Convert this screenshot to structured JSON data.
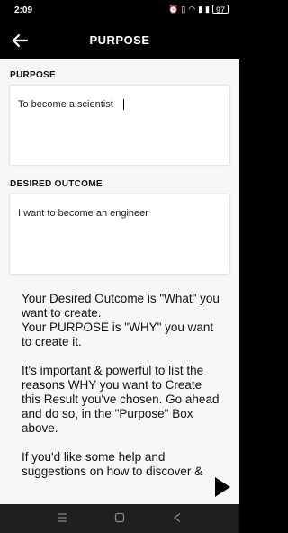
{
  "status": {
    "time": "2:09",
    "icons": [
      "alarm-icon",
      "vibrate-icon",
      "wifi-icon",
      "signal-icon",
      "signal-icon"
    ],
    "battery": "97"
  },
  "header": {
    "title": "PURPOSE"
  },
  "purpose": {
    "label": "PURPOSE",
    "value": "To become a scientist"
  },
  "desired_outcome": {
    "label": "DESIRED OUTCOME",
    "value": "I want to become an engineer"
  },
  "info": {
    "para1_line1": "Your Desired Outcome is \"What\" you want to create.",
    "para1_line2": "Your PURPOSE is \"WHY\" you want to create it.",
    "para2": "It's important & powerful to list the reasons WHY you want to Create this Result you've chosen. Go ahead and do so, in the \"Purpose\" Box above.",
    "para3": "If you'd like some help and suggestions on how to discover &"
  }
}
